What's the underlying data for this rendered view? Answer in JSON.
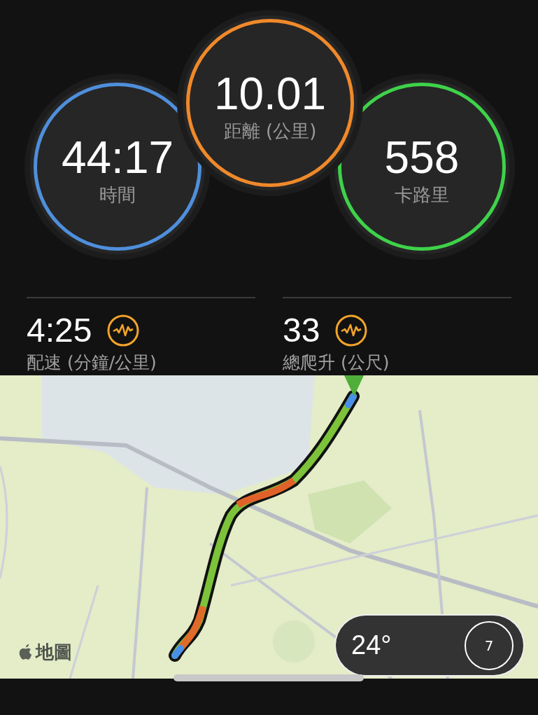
{
  "rings": [
    {
      "value": "44:17",
      "label": "時間",
      "color": "#4f8fdc"
    },
    {
      "value": "10.01",
      "label": "距離 (公里)",
      "color": "#f0892a"
    },
    {
      "value": "558",
      "label": "卡路里",
      "color": "#3ed24a"
    }
  ],
  "stats": [
    {
      "value": "4:25",
      "label": "配速 (分鐘/公里)"
    },
    {
      "value": "33",
      "label": "總爬升 (公尺)"
    }
  ],
  "map": {
    "kind": "picture",
    "attribution": "地圖",
    "weather": {
      "temperature": "24°",
      "index": "7"
    }
  }
}
